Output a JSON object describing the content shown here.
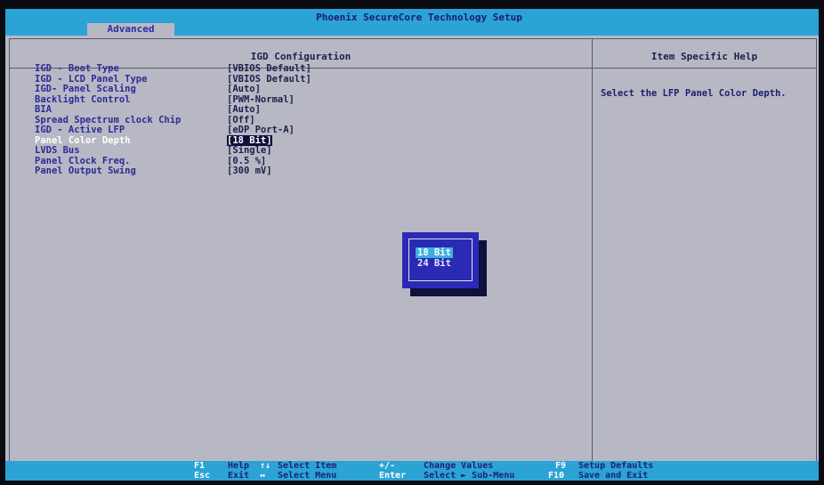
{
  "header": {
    "title": "Phoenix SecureCore Technology Setup",
    "tab": "Advanced"
  },
  "main": {
    "section_title": "IGD Configuration",
    "settings": [
      {
        "label": "IGD - Boot Type",
        "value": "[VBIOS Default]"
      },
      {
        "label": "IGD - LCD Panel Type",
        "value": "[VBIOS Default]"
      },
      {
        "label": "IGD- Panel Scaling",
        "value": "[Auto]"
      },
      {
        "label": "Backlight Control",
        "value": "[PWM-Normal]"
      },
      {
        "label": "BIA",
        "value": "[Auto]"
      },
      {
        "label": "Spread Spectrum clock Chip",
        "value": "[Off]"
      },
      {
        "label": "IGD - Active LFP",
        "value": "[eDP Port-A]"
      },
      {
        "label": "Panel Color Depth",
        "value": "[18 Bit]"
      },
      {
        "label": "LVDS Bus",
        "value": "[Single]"
      },
      {
        "label": "Panel Clock Freq.",
        "value": "[0.5 %]"
      },
      {
        "label": "Panel Output Swing",
        "value": "[300 mV]"
      }
    ],
    "selected_index": 7
  },
  "help": {
    "title": "Item Specific Help",
    "text": "Select the LFP Panel Color Depth."
  },
  "popup": {
    "options": [
      "18 Bit",
      "24 Bit"
    ],
    "selected": "18 Bit"
  },
  "footer": {
    "row1": [
      {
        "key": "F1",
        "desc": "Help"
      },
      {
        "key": "↑↓",
        "desc": "Select Item"
      },
      {
        "key": "+/-",
        "desc": "Change Values"
      },
      {
        "key": "F9",
        "desc": "Setup Defaults"
      }
    ],
    "row2": [
      {
        "key": "Esc",
        "desc": "Exit"
      },
      {
        "key": "↔",
        "desc": "Select Menu"
      },
      {
        "key": "Enter",
        "desc": "Select ► Sub-Menu"
      },
      {
        "key": "F10",
        "desc": "Save and Exit"
      }
    ]
  },
  "colors": {
    "bar": "#2ba3d4",
    "panel": "#b8b8c4",
    "label": "#2b2b98",
    "popup": "#2a2ab4",
    "highlight": "#3ab0e0"
  }
}
